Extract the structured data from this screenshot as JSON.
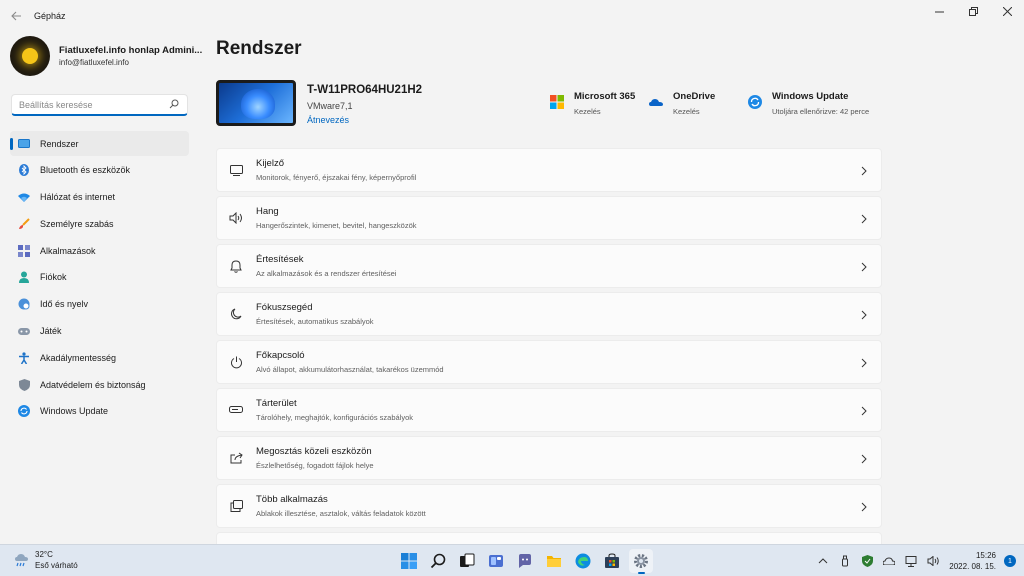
{
  "window": {
    "title": "Gépház",
    "back_icon": "back-arrow-icon",
    "controls": [
      "minimize-icon",
      "restore-icon",
      "close-icon"
    ]
  },
  "profile": {
    "name": "Fiatluxefel.info honlap Admini...",
    "email": "info@fiatluxefel.info"
  },
  "search": {
    "placeholder": "Beállítás keresése",
    "value": ""
  },
  "sidebar": {
    "items": [
      {
        "label": "Rendszer",
        "icon": "system-icon",
        "active": true
      },
      {
        "label": "Bluetooth és eszközök",
        "icon": "bluetooth-icon"
      },
      {
        "label": "Hálózat és internet",
        "icon": "wifi-icon"
      },
      {
        "label": "Személyre szabás",
        "icon": "brush-icon"
      },
      {
        "label": "Alkalmazások",
        "icon": "apps-icon"
      },
      {
        "label": "Fiókok",
        "icon": "account-icon"
      },
      {
        "label": "Idő és nyelv",
        "icon": "globe-clock-icon"
      },
      {
        "label": "Játék",
        "icon": "gamepad-icon"
      },
      {
        "label": "Akadálymentesség",
        "icon": "accessibility-icon"
      },
      {
        "label": "Adatvédelem és biztonság",
        "icon": "shield-icon"
      },
      {
        "label": "Windows Update",
        "icon": "update-icon"
      }
    ]
  },
  "main": {
    "title": "Rendszer",
    "device": {
      "name": "T-W11PRO64HU21H2",
      "model": "VMware7,1",
      "rename_label": "Átnevezés"
    },
    "quick": [
      {
        "title": "Microsoft 365",
        "sub": "Kezelés",
        "icon": "microsoft-logo-icon"
      },
      {
        "title": "OneDrive",
        "sub": "Kezelés",
        "icon": "onedrive-cloud-icon"
      },
      {
        "title": "Windows Update",
        "sub": "Utoljára ellenőrizve: 42 perce",
        "icon": "update-icon"
      }
    ],
    "cards": [
      {
        "title": "Kijelző",
        "sub": "Monitorok, fényerő, éjszakai fény, képernyőprofil",
        "icon": "display-icon"
      },
      {
        "title": "Hang",
        "sub": "Hangerőszintek, kimenet, bevitel, hangeszközök",
        "icon": "speaker-icon"
      },
      {
        "title": "Értesítések",
        "sub": "Az alkalmazások és a rendszer értesítései",
        "icon": "bell-icon"
      },
      {
        "title": "Fókuszsegéd",
        "sub": "Értesítések, automatikus szabályok",
        "icon": "moon-icon"
      },
      {
        "title": "Főkapcsoló",
        "sub": "Alvó állapot, akkumulátorhasználat, takarékos üzemmód",
        "icon": "power-icon"
      },
      {
        "title": "Tárterület",
        "sub": "Tárolóhely, meghajtók, konfigurációs szabályok",
        "icon": "storage-icon"
      },
      {
        "title": "Megosztás közeli eszközön",
        "sub": "Észlelhetőség, fogadott fájlok helye",
        "icon": "share-icon"
      },
      {
        "title": "Több alkalmazás",
        "sub": "Ablakok illesztése, asztalok, váltás feladatok között",
        "icon": "multitask-icon"
      },
      {
        "title": "",
        "sub": "",
        "icon": ""
      }
    ]
  },
  "taskbar": {
    "weather": {
      "temp": "32°C",
      "desc": "Eső várható",
      "icon": "rain-cloud-icon"
    },
    "apps": [
      "start-icon",
      "search-icon",
      "task-view-icon",
      "widgets-icon",
      "teams-chat-icon",
      "file-explorer-icon",
      "edge-icon",
      "store-icon",
      "settings-gear-icon"
    ],
    "clock": {
      "time": "15:26",
      "date": "2022. 08. 15."
    },
    "notification_count": "1"
  }
}
